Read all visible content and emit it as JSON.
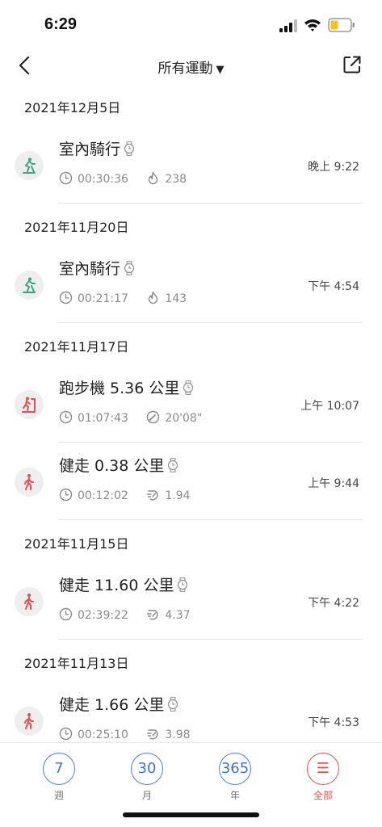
{
  "status_bar": {
    "time": "6:29"
  },
  "nav": {
    "title": "所有運動",
    "dropdown_glyph": "▼"
  },
  "groups": [
    {
      "date": "2021年12月5日",
      "items": [
        {
          "type": "cycling",
          "title": "室內騎行",
          "duration": "00:30:36",
          "metric_icon": "flame-icon",
          "metric": "238",
          "time": "晚上 9:22"
        }
      ]
    },
    {
      "date": "2021年11月20日",
      "items": [
        {
          "type": "cycling",
          "title": "室內騎行",
          "duration": "00:21:17",
          "metric_icon": "flame-icon",
          "metric": "143",
          "time": "下午 4:54"
        }
      ]
    },
    {
      "date": "2021年11月17日",
      "items": [
        {
          "type": "treadmill",
          "title": "跑步機 5.36 公里",
          "duration": "01:07:43",
          "metric_icon": "pace-icon",
          "metric": "20'08\"",
          "time": "上午 10:07"
        },
        {
          "type": "walking",
          "title": "健走 0.38 公里",
          "duration": "00:12:02",
          "metric_icon": "speed-icon",
          "metric": "1.94",
          "time": "上午 9:44"
        }
      ]
    },
    {
      "date": "2021年11月15日",
      "items": [
        {
          "type": "walking",
          "title": "健走 11.60 公里",
          "duration": "02:39:22",
          "metric_icon": "speed-icon",
          "metric": "4.37",
          "time": "下午 4:22"
        }
      ]
    },
    {
      "date": "2021年11月13日",
      "items": [
        {
          "type": "walking",
          "title": "健走 1.66 公里",
          "duration": "00:25:10",
          "metric_icon": "speed-icon",
          "metric": "3.98",
          "time": "下午 4:53"
        }
      ]
    }
  ],
  "tabs": [
    {
      "symbol": "7",
      "label": "週",
      "active": false
    },
    {
      "symbol": "30",
      "label": "月",
      "active": false
    },
    {
      "symbol": "365",
      "label": "年",
      "active": false
    },
    {
      "symbol": "☰",
      "label": "全部",
      "active": true
    }
  ],
  "colors": {
    "cycling": "#3aa67a",
    "treadmill": "#e8504a",
    "walking": "#e8504a",
    "tab_blue": "#3d74dc",
    "tab_active": "#e8504a"
  }
}
